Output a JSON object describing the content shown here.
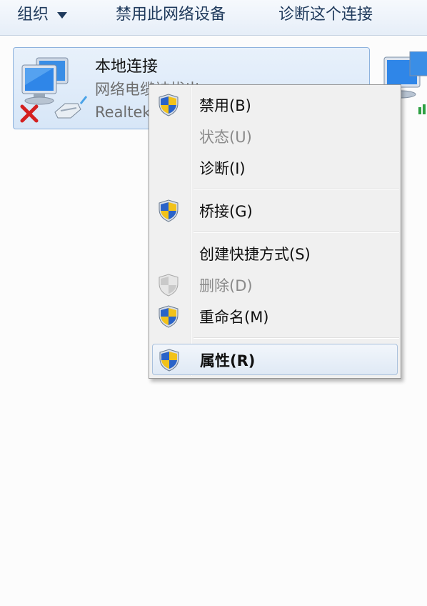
{
  "toolbar": {
    "organize_label": "组织",
    "disable_device_label": "禁用此网络设备",
    "diagnose_label": "诊断这个连接"
  },
  "connection": {
    "name": "本地连接",
    "status": "网络电缆被拔出",
    "device": "Realtek"
  },
  "context_menu": {
    "items": [
      {
        "label": "禁用(B)",
        "icon": "uac-shield-icon",
        "enabled": true
      },
      {
        "label": "状态(U)",
        "icon": "",
        "enabled": false
      },
      {
        "label": "诊断(I)",
        "icon": "",
        "enabled": true
      },
      {
        "label": "桥接(G)",
        "icon": "uac-shield-icon",
        "enabled": true
      },
      {
        "label": "创建快捷方式(S)",
        "icon": "",
        "enabled": true
      },
      {
        "label": "删除(D)",
        "icon": "uac-shield-icon",
        "enabled": false
      },
      {
        "label": "重命名(M)",
        "icon": "uac-shield-icon",
        "enabled": true
      },
      {
        "label": "属性(R)",
        "icon": "uac-shield-icon",
        "enabled": true,
        "bold": true,
        "highlighted": true
      }
    ]
  },
  "colors": {
    "toolbar_text": "#1f3a5c",
    "selection_border": "#8db2dd",
    "disconnected_x": "#d42020",
    "shield_blue": "#2a63c8",
    "shield_yellow": "#f2c21a"
  }
}
